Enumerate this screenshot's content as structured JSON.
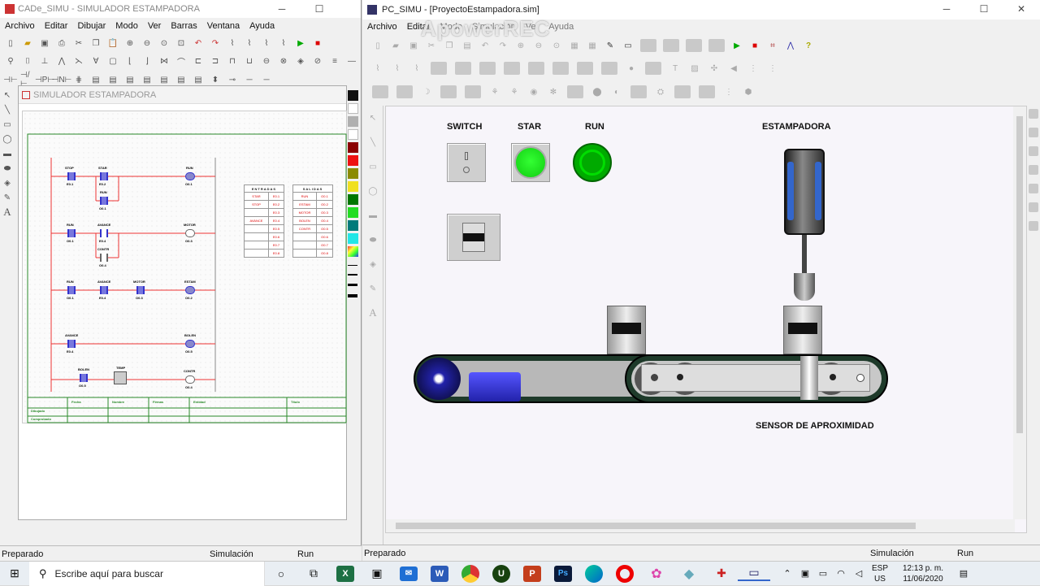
{
  "left_window": {
    "title": "CADe_SIMU - SIMULADOR ESTAMPADORA",
    "menu": [
      "Archivo",
      "Editar",
      "Dibujar",
      "Modo",
      "Ver",
      "Barras",
      "Ventana",
      "Ayuda"
    ],
    "doc_title": "SIMULADOR ESTAMPADORA",
    "status": [
      "Preparado",
      "Simulación",
      "Run"
    ],
    "io_table": {
      "inputs_header": "ENTRADAS",
      "outputs_header": "SALIDAS",
      "inputs": [
        "STAR",
        "STOP",
        "",
        "AVANCE",
        "",
        "",
        "",
        ""
      ],
      "input_addrs": [
        "E0.1",
        "E0.2",
        "E0.3",
        "E0.4",
        "E0.5",
        "E0.6",
        "E0.7",
        "E0.8"
      ],
      "outputs": [
        "RUN",
        "ESTAM",
        "MOTOR",
        "BOLEN",
        "CONTR",
        "",
        "",
        ""
      ],
      "output_addrs": [
        "O0.1",
        "O0.2",
        "O0.3",
        "O0.4",
        "O0.5",
        "O0.6",
        "O0.7",
        "O0.8"
      ]
    },
    "ladder": {
      "r1": {
        "c1": "STOP",
        "c1a": "E0.1",
        "c2": "STAR",
        "c2a": "E0.2",
        "c3": "RUN",
        "c3a": "O0.1",
        "coil": "RUN",
        "coila": "O0.1"
      },
      "r2": {
        "c1": "RUN",
        "c1a": "O0.1",
        "c2": "AVANCE",
        "c2a": "E0.4",
        "c3": "CONTR",
        "c3a": "O0.4",
        "coil": "MOTOR",
        "coila": "O0.3"
      },
      "r3": {
        "c1": "RUN",
        "c1a": "O0.1",
        "c2": "AVANCE",
        "c2a": "E0.4",
        "c3": "MOTOR",
        "c3a": "O0.3",
        "coil": "ESTAM",
        "coila": "O0.2"
      },
      "r4": {
        "c1": "AVANCE",
        "c1a": "E0.4",
        "coil": "BOLEN",
        "coila": "O0.5"
      },
      "r5": {
        "c1": "BOLEN",
        "c1a": "O0.5",
        "timer": "TEMP",
        "coil": "CONTR",
        "coila": "O0.4"
      }
    },
    "footer": {
      "fecha": "Fecha",
      "nombre": "Nombre",
      "firmas": "Firmas",
      "entidad": "Entidad",
      "titulo": "Título",
      "dibujado": "Dibujado",
      "comprobado": "Comprobado"
    }
  },
  "right_window": {
    "title": "PC_SIMU - [ProyectoEstampadora.sim]",
    "menu": [
      "Archivo",
      "Editar",
      "Modo",
      "Simulación",
      "Ver",
      "Ayuda"
    ],
    "watermark": "ApowerREC",
    "labels": {
      "switch": "SWITCH",
      "star": "STAR",
      "run": "RUN",
      "estampadora": "ESTAMPADORA",
      "sensor": "SENSOR DE APROXIMIDAD"
    },
    "status": [
      "Preparado",
      "Simulación",
      "Run"
    ]
  },
  "palette_colors": [
    "#111111",
    "#ffffff",
    "#b0b0b0",
    "#ffffff",
    "#8b0000",
    "#ee1111",
    "#8b8b00",
    "#f0e020",
    "#007700",
    "#22dd22",
    "#007a7a",
    "#22e6e6",
    "#6aa0ff"
  ],
  "taskbar": {
    "search_placeholder": "Escribe aquí para buscar",
    "lang": "ESP",
    "region": "US",
    "time": "12:13 p. m.",
    "date": "11/06/2020"
  }
}
